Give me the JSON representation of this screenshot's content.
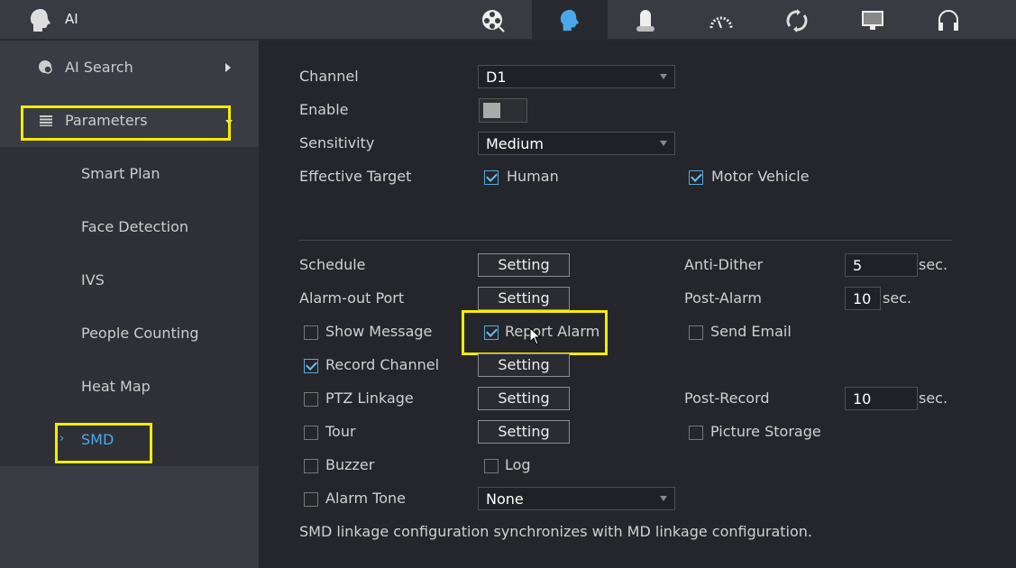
{
  "header": {
    "title": "AI",
    "tabs": [
      {
        "icon": "film-reel-icon"
      },
      {
        "icon": "ai-head-icon",
        "active": true
      },
      {
        "icon": "alarm-light-icon"
      },
      {
        "icon": "gauge-icon"
      },
      {
        "icon": "refresh-icon"
      },
      {
        "icon": "monitor-icon"
      },
      {
        "icon": "headset-icon"
      }
    ]
  },
  "sidebar": {
    "ai_search": "AI Search",
    "parameters": "Parameters",
    "items": [
      "Smart Plan",
      "Face Detection",
      "IVS",
      "People Counting",
      "Heat Map",
      "SMD"
    ],
    "active": "SMD"
  },
  "form": {
    "channel_label": "Channel",
    "channel_value": "D1",
    "enable_label": "Enable",
    "enable_on": false,
    "sensitivity_label": "Sensitivity",
    "sensitivity_value": "Medium",
    "target_label": "Effective Target",
    "human": "Human",
    "human_checked": true,
    "motor": "Motor Vehicle",
    "motor_checked": true,
    "schedule": "Schedule",
    "alarm_out": "Alarm-out Port",
    "setting": "Setting",
    "anti_dither": "Anti-Dither",
    "anti_dither_value": "5",
    "post_alarm": "Post-Alarm",
    "post_alarm_value": "10",
    "sec": "sec.",
    "show_message": "Show Message",
    "show_message_checked": false,
    "report_alarm": "Report Alarm",
    "report_alarm_checked": true,
    "send_email": "Send Email",
    "send_email_checked": false,
    "record_channel": "Record Channel",
    "record_channel_checked": true,
    "ptz": "PTZ Linkage",
    "ptz_checked": false,
    "post_record": "Post-Record",
    "post_record_value": "10",
    "tour": "Tour",
    "tour_checked": false,
    "picture_storage": "Picture Storage",
    "picture_storage_checked": false,
    "buzzer": "Buzzer",
    "buzzer_checked": false,
    "log": "Log",
    "log_checked": false,
    "alarm_tone": "Alarm Tone",
    "alarm_tone_value": "None",
    "note": "SMD linkage configuration synchronizes with MD linkage configuration."
  },
  "colors": {
    "accent": "#4aa8e8",
    "highlight": "#f5ec00"
  }
}
